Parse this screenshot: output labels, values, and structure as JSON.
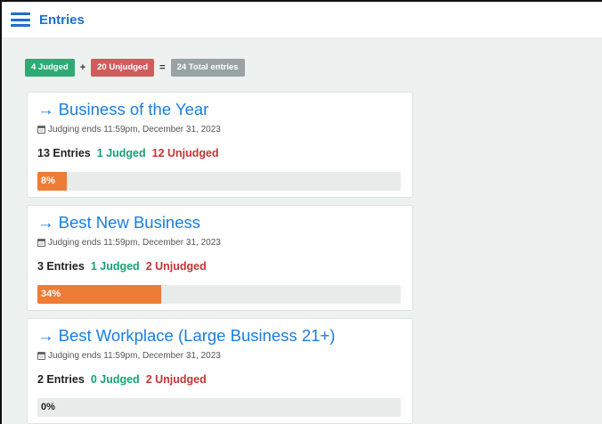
{
  "header": {
    "title": "Entries"
  },
  "summary": {
    "judged": "4 Judged",
    "plus": "+",
    "unjudged": "20 Unjudged",
    "equals": "=",
    "total": "24 Total entries"
  },
  "colors": {
    "accent": "#1a7ee0",
    "judged": "#17a272",
    "unjudged": "#c23535",
    "progress": "#ed7c36"
  },
  "categories": [
    {
      "title": "→ Business of the Year",
      "deadline": "Judging ends 11:59pm, December 31, 2023",
      "entries": "13 Entries",
      "judged": "1 Judged",
      "unjudged": "12 Unjudged",
      "progress_label": "8%",
      "progress": 8
    },
    {
      "title": "→ Best New Business",
      "deadline": "Judging ends 11:59pm, December 31, 2023",
      "entries": "3 Entries",
      "judged": "1 Judged",
      "unjudged": "2 Unjudged",
      "progress_label": "34%",
      "progress": 34
    },
    {
      "title": "→ Best Workplace (Large Business 21+)",
      "deadline": "Judging ends 11:59pm, December 31, 2023",
      "entries": "2 Entries",
      "judged": "0 Judged",
      "unjudged": "2 Unjudged",
      "progress_label": "0%",
      "progress": 0
    }
  ]
}
